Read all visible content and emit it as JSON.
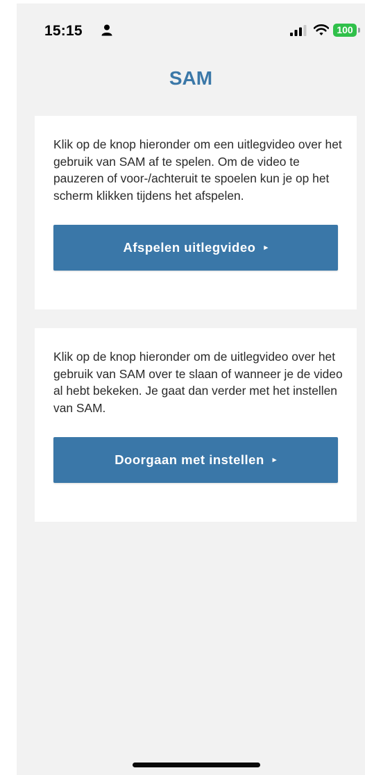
{
  "status_bar": {
    "time": "15:15",
    "battery": "100"
  },
  "header": {
    "title": "SAM"
  },
  "cards": [
    {
      "text": "Klik op de knop hieronder om een uitlegvideo over het gebruik van SAM af te spelen. Om de video te pauzeren of voor-/achteruit te spoelen kun je op het scherm klikken tijdens het afspelen.",
      "button_label": "Afspelen uitlegvideo",
      "button_icon": "▸"
    },
    {
      "text": "Klik op de knop hieronder om de uitlegvideo over het gebruik van SAM over te slaan of wanneer je de video al hebt bekeken. Je gaat dan verder met het instellen van SAM.",
      "button_label": "Doorgaan met instellen",
      "button_icon": "▸"
    }
  ],
  "colors": {
    "accent": "#3a77a8",
    "background": "#f2f2f2",
    "card": "#ffffff",
    "battery": "#30c04a"
  },
  "icons": [
    "person-icon",
    "signal-icon",
    "wifi-icon",
    "battery-icon",
    "play-arrow-icon"
  ]
}
